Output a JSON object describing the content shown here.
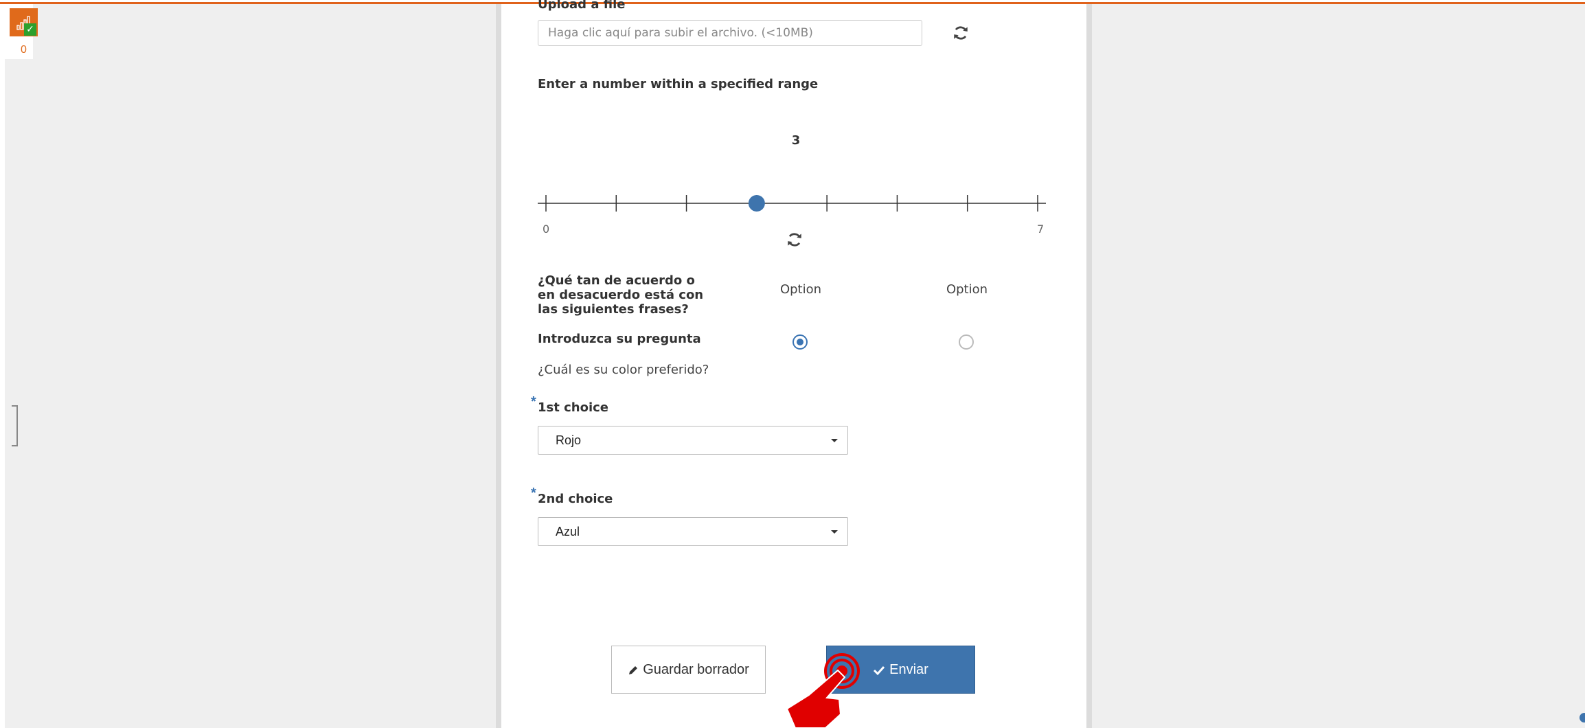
{
  "notifications": {
    "count": "0"
  },
  "upload": {
    "title": "Upload a file",
    "placeholder": "Haga clic aquí para subir el archivo. (<10MB)"
  },
  "range": {
    "title": "Enter a number within a specified range",
    "value": "3",
    "min_label": "0",
    "max_label": "7",
    "min": 0,
    "max": 7,
    "current": 3
  },
  "matrix": {
    "question": "¿Qué tan de acuerdo o en desacuerdo está con las siguientes frases?",
    "options": [
      "Option",
      "Option"
    ],
    "row_label": "Introduzca su pregunta",
    "selected_index": 0
  },
  "color_question": "¿Cuál es su color preferido?",
  "choice1": {
    "required_mark": "*",
    "label": "1st choice",
    "value": "Rojo"
  },
  "choice2": {
    "required_mark": "*",
    "label": "2nd choice",
    "value": "Azul"
  },
  "buttons": {
    "draft": "Guardar borrador",
    "send": "Enviar"
  },
  "colors": {
    "primary": "#3e74ad",
    "accent": "#e0621b",
    "success": "#2ca02c"
  }
}
